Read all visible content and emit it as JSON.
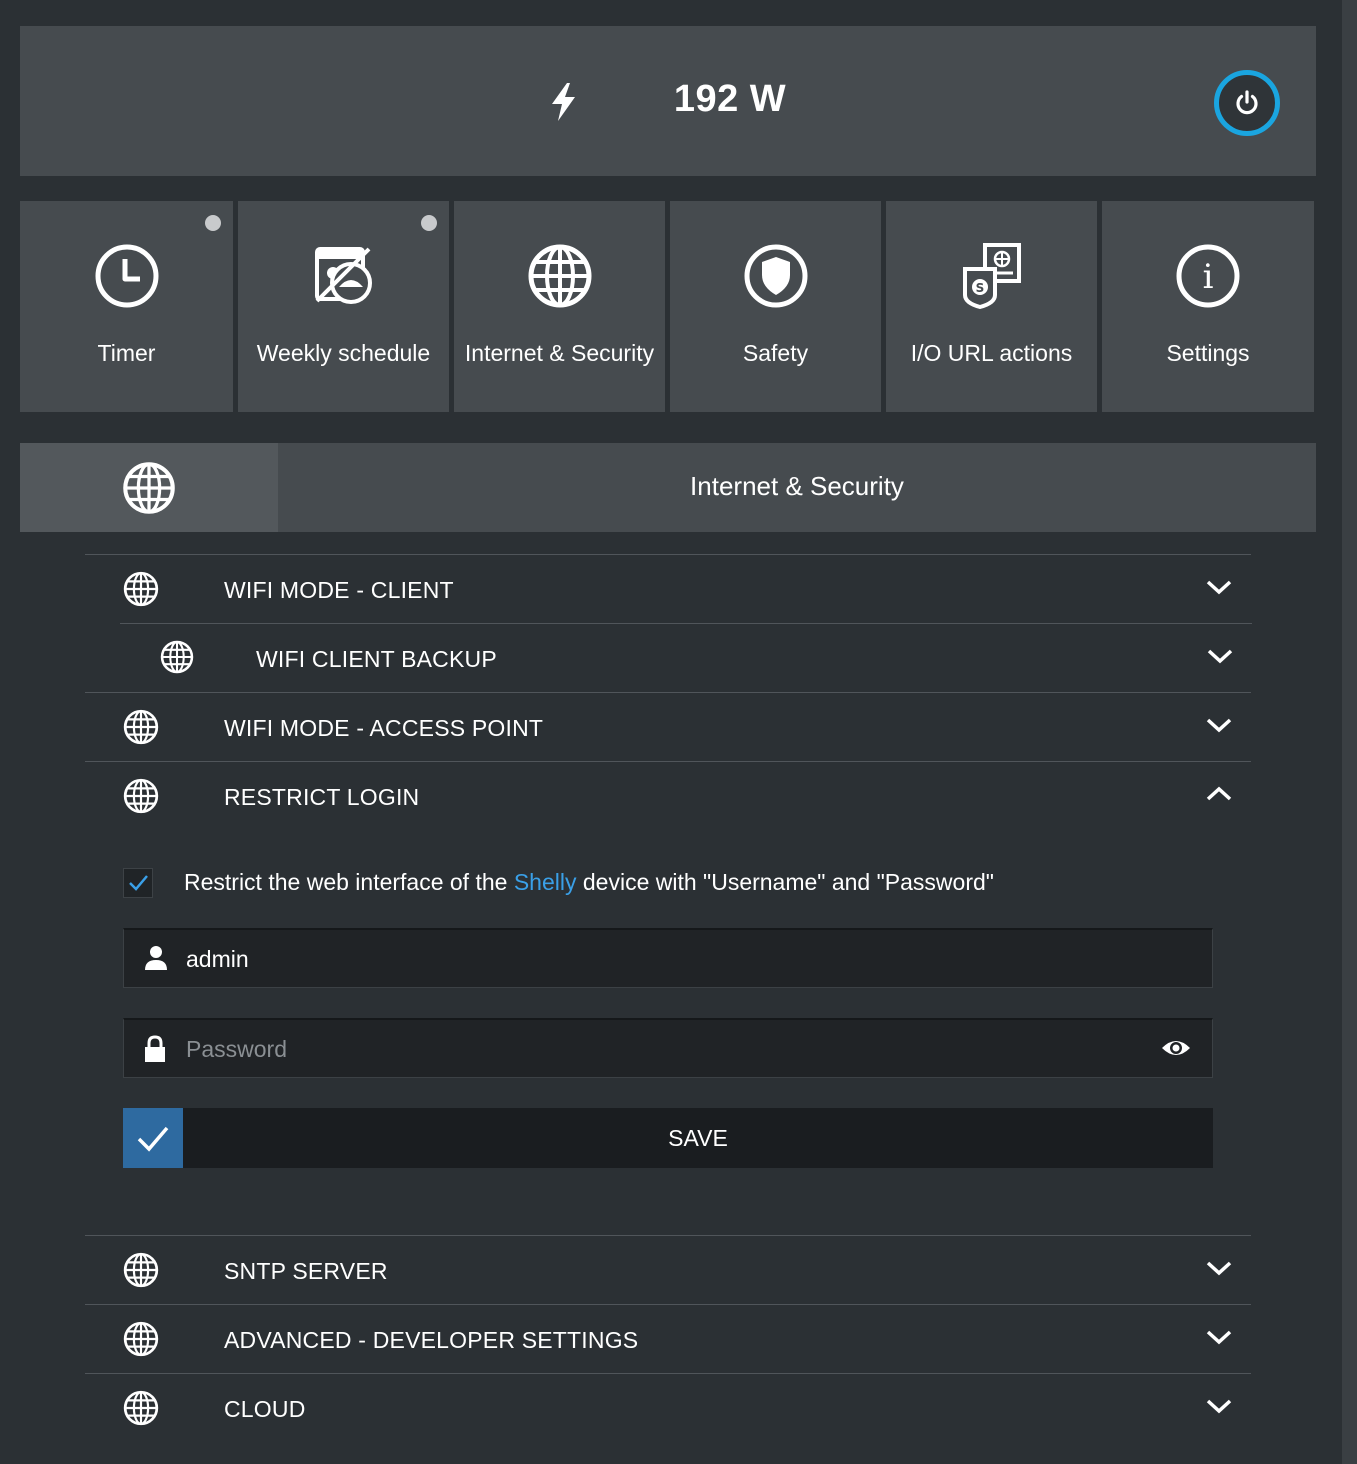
{
  "power": {
    "value": "192 W",
    "bolt_icon": "bolt-icon",
    "toggle_icon": "power-icon",
    "toggle_color": "#1aa5e0"
  },
  "tiles": [
    {
      "label": "Timer",
      "icon": "clock-icon",
      "indicator": true
    },
    {
      "label": "Weekly schedule",
      "icon": "schedule-icon",
      "indicator": true
    },
    {
      "label": "Internet & Security",
      "icon": "globe-icon",
      "indicator": false
    },
    {
      "label": "Safety",
      "icon": "shield-icon",
      "indicator": false
    },
    {
      "label": "I/O URL actions",
      "icon": "url-actions-icon",
      "indicator": false
    },
    {
      "label": "Settings",
      "icon": "info-icon",
      "indicator": false
    }
  ],
  "section": {
    "title": "Internet & Security",
    "icon": "globe-icon"
  },
  "rows": {
    "wifi_client": "WIFI MODE - CLIENT",
    "wifi_backup": "WIFI CLIENT BACKUP",
    "wifi_ap": "WIFI MODE - ACCESS POINT",
    "restrict_login": "RESTRICT LOGIN",
    "sntp": "SNTP SERVER",
    "advanced": "ADVANCED - DEVELOPER SETTINGS",
    "cloud": "CLOUD"
  },
  "restrict": {
    "checked": true,
    "text_before": "Restrict the web interface of the ",
    "link": "Shelly",
    "text_after": " device with \"Username\" and \"Password\"",
    "username_value": "admin",
    "password_placeholder": "Password",
    "save_label": "SAVE"
  },
  "colors": {
    "accent": "#1aa5e0",
    "link": "#3aa0e8",
    "save_icon_bg": "#2e6aa0",
    "panel": "#464b4f",
    "background": "#2b3034"
  }
}
